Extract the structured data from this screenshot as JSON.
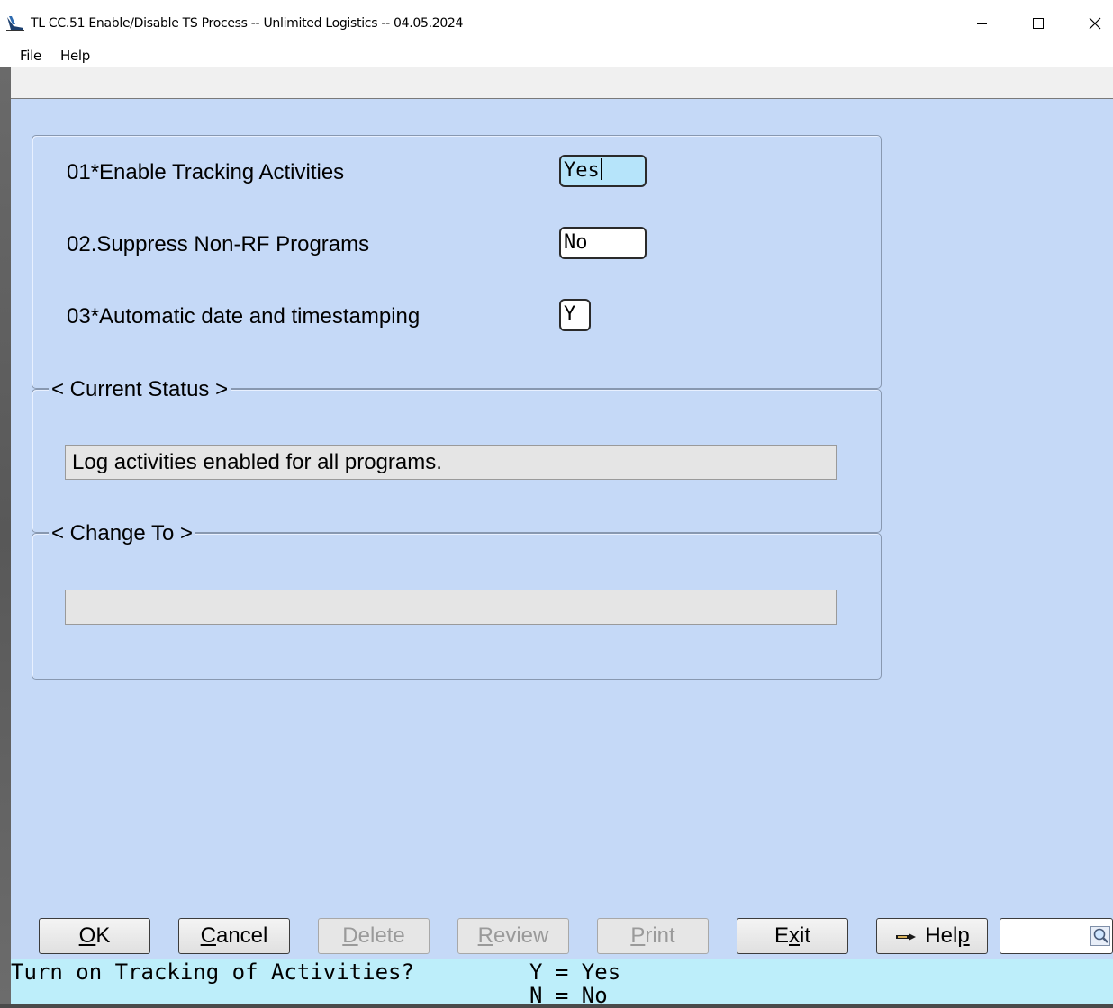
{
  "window": {
    "title": "TL CC.51 Enable/Disable TS Process -- Unlimited Logistics -- 04.05.2024",
    "icons": [
      "app-icon",
      "minimize-icon",
      "maximize-icon",
      "close-icon"
    ]
  },
  "menu": {
    "items": [
      "File",
      "Help"
    ]
  },
  "form": {
    "fields": [
      {
        "label": "01*Enable Tracking Activities",
        "value": "Yes"
      },
      {
        "label": "02.Suppress Non-RF Programs",
        "value": "No"
      },
      {
        "label": "03*Automatic date and timestamping",
        "value": "Y"
      }
    ],
    "current_status": {
      "title": "< Current Status >",
      "value": "Log activities enabled for all programs."
    },
    "change_to": {
      "title": "< Change To >",
      "value": ""
    }
  },
  "buttons": {
    "ok": {
      "pre": "",
      "ul": "O",
      "post": "K",
      "enabled": true
    },
    "cancel": {
      "pre": "",
      "ul": "C",
      "post": "ancel",
      "enabled": true
    },
    "delete": {
      "pre": "",
      "ul": "D",
      "post": "elete",
      "enabled": false
    },
    "review": {
      "pre": "",
      "ul": "R",
      "post": "eview",
      "enabled": false
    },
    "print": {
      "pre": "",
      "ul": "P",
      "post": "rint",
      "enabled": false
    },
    "exit": {
      "pre": "E",
      "ul": "x",
      "post": "it",
      "enabled": true
    },
    "help": {
      "pre": "Hel",
      "ul": "p",
      "post": "",
      "enabled": true,
      "icon": "pointing-hand-icon"
    },
    "search_icon": "magnifier-icon"
  },
  "statusbar": {
    "prompt": "Turn on Tracking of Activities?",
    "options": [
      "Y = Yes",
      "N = No"
    ]
  },
  "colors": {
    "client_bg": "#c5d9f7",
    "focused_field": "#b6e4fa",
    "statusbar_bg": "#bdeefa"
  }
}
